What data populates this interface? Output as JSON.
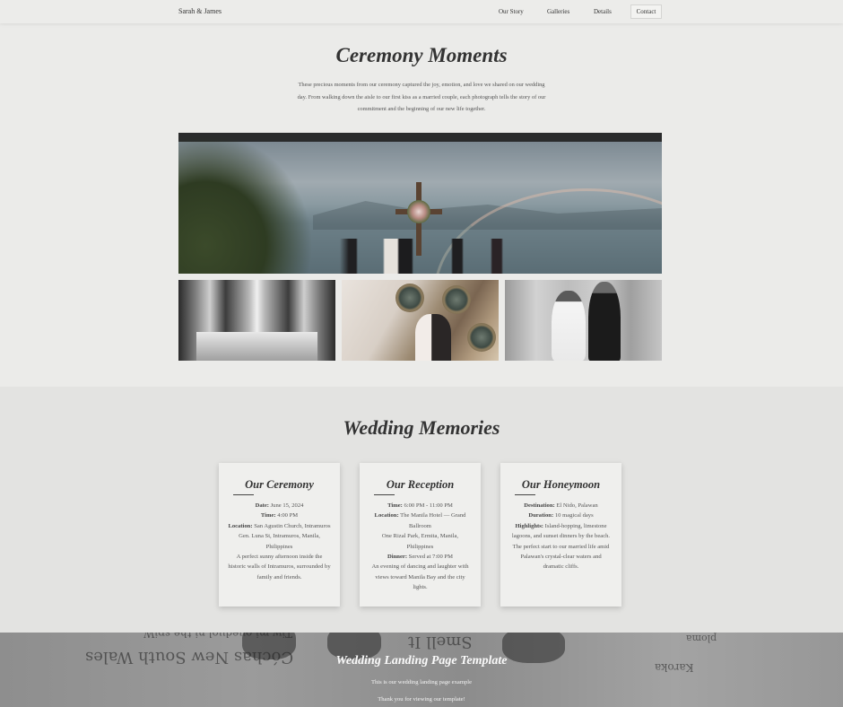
{
  "header": {
    "brand": "Sarah & James",
    "nav": [
      "Our Story",
      "Galleries",
      "Details"
    ],
    "contact": "Contact"
  },
  "ceremony": {
    "title": "Ceremony Moments",
    "description": "These precious moments from our ceremony captured the joy, emotion, and love we shared on our wedding day. From walking down the aisle to our first kiss as a married couple, each photograph tells the story of our commitment and the beginning of our new life together."
  },
  "memories": {
    "title": "Wedding Memories",
    "cards": [
      {
        "title": "Our Ceremony",
        "lines": [
          {
            "label": "Date:",
            "text": " June 15, 2024"
          },
          {
            "label": "Time:",
            "text": " 4:00 PM"
          },
          {
            "label": "Location:",
            "text": " San Agustin Church, Intramuros"
          },
          {
            "label": "",
            "text": "Gen. Luna St, Intramuros, Manila, Philippines"
          },
          {
            "label": "",
            "text": "A perfect sunny afternoon inside the historic walls of Intramuros, surrounded by family and friends."
          }
        ]
      },
      {
        "title": "Our Reception",
        "lines": [
          {
            "label": "Time:",
            "text": " 6:00 PM - 11:00 PM"
          },
          {
            "label": "Location:",
            "text": " The Manila Hotel — Grand Ballroom"
          },
          {
            "label": "",
            "text": "One Rizal Park, Ermita, Manila, Philippines"
          },
          {
            "label": "Dinner:",
            "text": " Served at 7:00 PM"
          },
          {
            "label": "",
            "text": "An evening of dancing and laughter with views toward Manila Bay and the city lights."
          }
        ]
      },
      {
        "title": "Our Honeymoon",
        "lines": [
          {
            "label": "Destination:",
            "text": " El Nido, Palawan"
          },
          {
            "label": "Duration:",
            "text": " 10 magical days"
          },
          {
            "label": "Highlights:",
            "text": " Island-hopping, limestone lagoons, and sunset dinners by the beach."
          },
          {
            "label": "",
            "text": "The perfect start to our married life amid Palawan's crystal-clear waters and dramatic cliffs."
          }
        ]
      }
    ]
  },
  "footer": {
    "title": "Wedding Landing Page Template",
    "line1": "This is our wedding landing page example",
    "line2": "Thank you for viewing our template!",
    "background_text": [
      "Cóchas New South Wales",
      "Smell It",
      "Tiw mi oueduol ni the spiW",
      "Karoka",
      "ploma"
    ]
  }
}
